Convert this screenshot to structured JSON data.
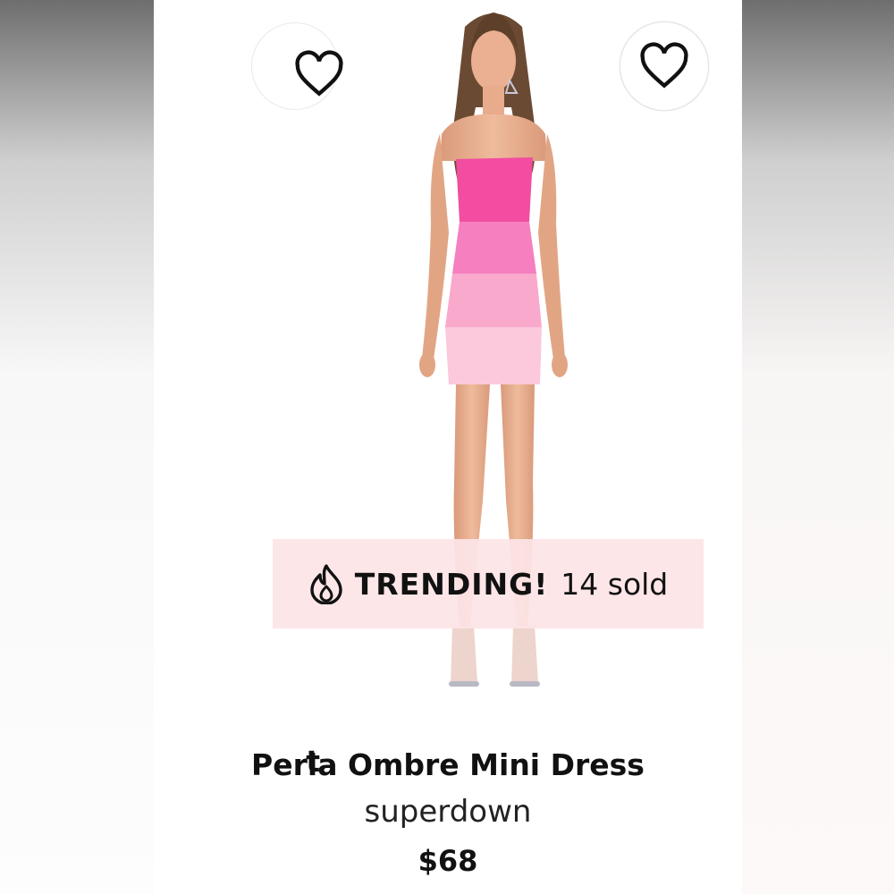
{
  "previous_card": {
    "title_tail": "t"
  },
  "product": {
    "title": "Perla Ombre Mini Dress",
    "brand": "superdown",
    "price": "$68",
    "image_alt": "Model wearing pink ombre strapless mini dress"
  },
  "badge": {
    "icon": "flame-icon",
    "label": "TRENDING!",
    "count_text": "14 sold"
  },
  "icons": {
    "favorite": "heart-icon"
  },
  "colors": {
    "stripe1": "#f24da0",
    "stripe2": "#f57fbf",
    "stripe3": "#f8a9cc",
    "stripe4": "#fbc8dc",
    "badge_bg": "#fce4e6"
  }
}
